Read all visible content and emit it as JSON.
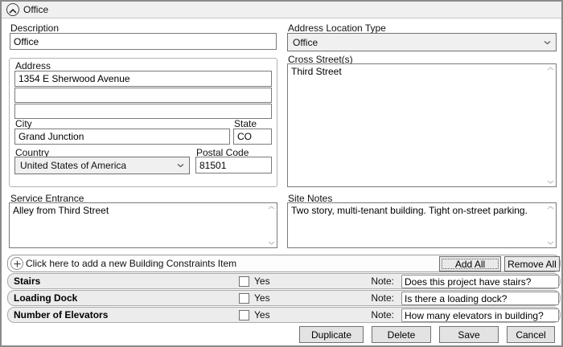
{
  "colors": {
    "header_bg": "#f0f0f0",
    "row_bg": "#ececec",
    "window_border": "#8a8a8a"
  },
  "header": {
    "title": "Office"
  },
  "form": {
    "description": {
      "label": "Description",
      "value": "Office"
    },
    "address": {
      "group_label": "Address",
      "line1": "1354 E Sherwood Avenue",
      "line2": "",
      "line3": "",
      "city_label": "City",
      "city": "Grand Junction",
      "state_label": "State",
      "state": "CO",
      "country_label": "Country",
      "country": "United States of America",
      "postal_label": "Postal Code",
      "postal": "81501"
    },
    "service_entrance": {
      "label": "Service Entrance",
      "value": "Alley from Third Street"
    },
    "location_type": {
      "label": "Address Location Type",
      "value": "Office"
    },
    "cross_streets": {
      "label": "Cross Street(s)",
      "value": "Third Street"
    },
    "site_notes": {
      "label": "Site Notes",
      "value": "Two story, multi-tenant building. Tight on-street parking."
    }
  },
  "constraints": {
    "add_prompt": "Click here to add a new Building Constraints Item",
    "add_all": "Add All",
    "remove_all": "Remove All",
    "yes_label": "Yes",
    "note_label": "Note:",
    "rows": [
      {
        "name": "Stairs",
        "checked": false,
        "note": "Does this project have stairs?"
      },
      {
        "name": "Loading Dock",
        "checked": false,
        "note": "Is there a loading dock?"
      },
      {
        "name": "Number of Elevators",
        "checked": false,
        "note": "How many elevators in building?"
      }
    ]
  },
  "footer": {
    "duplicate": "Duplicate",
    "delete": "Delete",
    "save": "Save",
    "cancel": "Cancel"
  },
  "icons": {
    "collapse": "chevron-up-icon",
    "dropdown": "chevron-down-icon",
    "add": "plus-circle-icon",
    "scroll_up": "chevron-up-icon",
    "scroll_down": "chevron-down-icon"
  }
}
